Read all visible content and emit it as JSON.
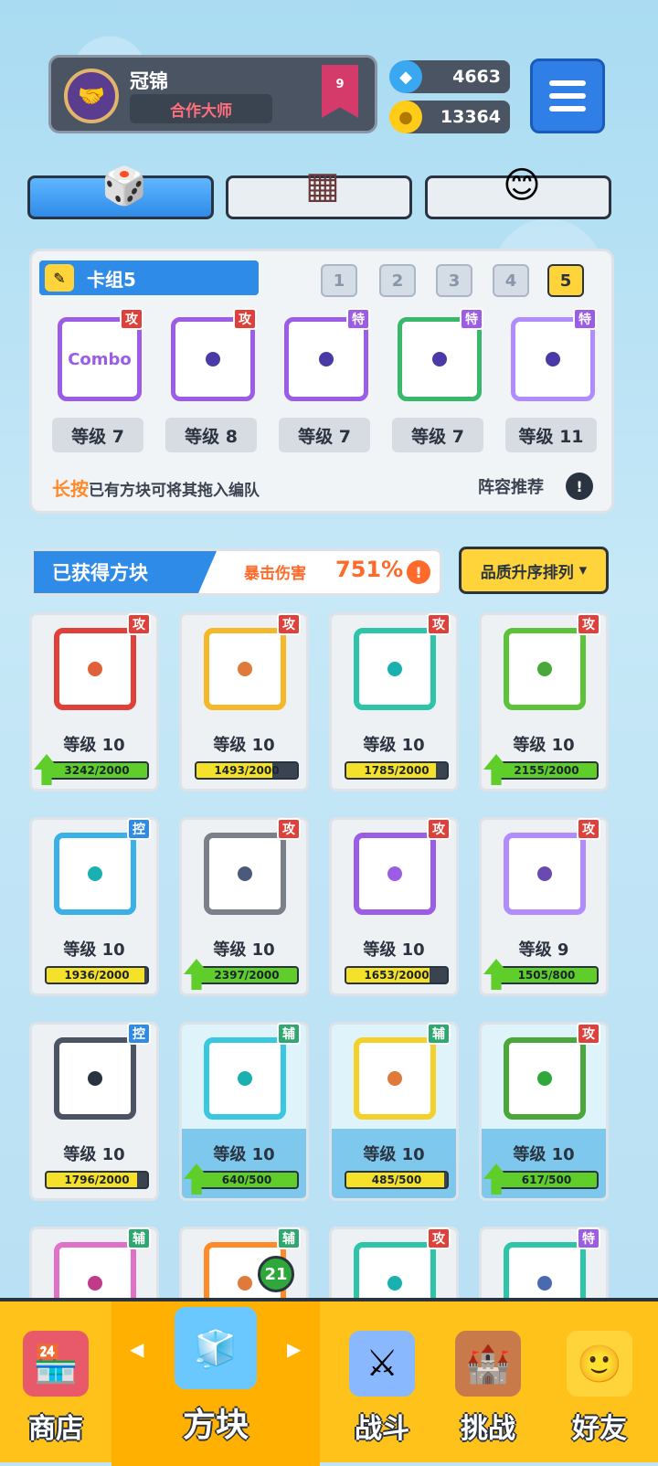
{
  "profile": {
    "name": "冠锦",
    "title": "合作大师",
    "rank": "9"
  },
  "currency": {
    "gems": "4663",
    "coins": "13364"
  },
  "deck": {
    "label": "卡组5",
    "numbers": [
      "1",
      "2",
      "3",
      "4",
      "5"
    ],
    "active": "5",
    "slots": [
      {
        "badge": "攻",
        "badge_color": "#e0403a",
        "color": "#9b5de5",
        "level": "等级 7",
        "text": "Combo"
      },
      {
        "badge": "攻",
        "badge_color": "#e0403a",
        "color": "#9b5de5",
        "level": "等级 8",
        "text": ""
      },
      {
        "badge": "特",
        "badge_color": "#9b5de5",
        "color": "#9b5de5",
        "level": "等级 7",
        "text": ""
      },
      {
        "badge": "特",
        "badge_color": "#9b5de5",
        "color": "#38b86a",
        "level": "等级 7",
        "text": ""
      },
      {
        "badge": "特",
        "badge_color": "#9b5de5",
        "color": "#b08cff",
        "level": "等级 11",
        "text": ""
      }
    ],
    "hint_em": "长按",
    "hint_rest": "已有方块可将其拖入编队",
    "recommend": "阵容推荐"
  },
  "owned": {
    "label": "已获得方块",
    "crit_label": "暴击伤害",
    "crit_value": "751%",
    "sort": "品质升序排列"
  },
  "cards": [
    {
      "badge": "攻",
      "badge_color": "#e0403a",
      "border": "#e0403a",
      "dot": "#e0603a",
      "level": "等级 10",
      "progress": "3242/2000",
      "frac": 1,
      "arrow": true,
      "bluebg": false
    },
    {
      "badge": "攻",
      "badge_color": "#e0403a",
      "border": "#f5b82a",
      "dot": "#e07a3a",
      "level": "等级 10",
      "progress": "1493/2000",
      "frac": 0.75,
      "arrow": false,
      "bluebg": false
    },
    {
      "badge": "攻",
      "badge_color": "#e0403a",
      "border": "#2ec4a8",
      "dot": "#1ab0b0",
      "level": "等级 10",
      "progress": "1785/2000",
      "frac": 0.89,
      "arrow": false,
      "bluebg": false
    },
    {
      "badge": "攻",
      "badge_color": "#e0403a",
      "border": "#5cc23a",
      "dot": "#4aa83a",
      "level": "等级 10",
      "progress": "2155/2000",
      "frac": 1,
      "arrow": true,
      "bluebg": false
    },
    {
      "badge": "控",
      "badge_color": "#2f8be8",
      "border": "#3ab0e8",
      "dot": "#1ab0b0",
      "level": "等级 10",
      "progress": "1936/2000",
      "frac": 0.97,
      "arrow": false,
      "bluebg": false
    },
    {
      "badge": "攻",
      "badge_color": "#e0403a",
      "border": "#7a7f88",
      "dot": "#4a5a7a",
      "level": "等级 10",
      "progress": "2397/2000",
      "frac": 1,
      "arrow": true,
      "bluebg": false
    },
    {
      "badge": "攻",
      "badge_color": "#e0403a",
      "border": "#9b5de5",
      "dot": "#9b5de5",
      "level": "等级 10",
      "progress": "1653/2000",
      "frac": 0.83,
      "arrow": false,
      "bluebg": false
    },
    {
      "badge": "攻",
      "badge_color": "#e0403a",
      "border": "#b08cff",
      "dot": "#6a4ab0",
      "level": "等级 9",
      "progress": "1505/800",
      "frac": 1,
      "arrow": true,
      "bluebg": false
    },
    {
      "badge": "控",
      "badge_color": "#2f8be8",
      "border": "#4a5462",
      "dot": "#2a3340",
      "level": "等级 10",
      "progress": "1796/2000",
      "frac": 0.9,
      "arrow": false,
      "bluebg": false
    },
    {
      "badge": "辅",
      "badge_color": "#2ea870",
      "border": "#3ac8e0",
      "dot": "#1ab0b0",
      "level": "等级 10",
      "progress": "640/500",
      "frac": 1,
      "arrow": true,
      "bluebg": true
    },
    {
      "badge": "辅",
      "badge_color": "#2ea870",
      "border": "#f5d02a",
      "dot": "#e07a3a",
      "level": "等级 10",
      "progress": "485/500",
      "frac": 0.97,
      "arrow": false,
      "bluebg": true
    },
    {
      "badge": "攻",
      "badge_color": "#e0403a",
      "border": "#4aa83a",
      "dot": "#2ea83a",
      "level": "等级 10",
      "progress": "617/500",
      "frac": 1,
      "arrow": true,
      "bluebg": true
    },
    {
      "badge": "辅",
      "badge_color": "#2ea870",
      "border": "#e070c8",
      "dot": "#c03a8a",
      "level": "",
      "progress": "",
      "frac": 0,
      "arrow": false,
      "bluebg": false
    },
    {
      "badge": "辅",
      "badge_color": "#2ea870",
      "border": "#ff8a2a",
      "dot": "#e07a3a",
      "level": "",
      "progress": "",
      "frac": 0,
      "arrow": false,
      "bluebg": false
    },
    {
      "badge": "攻",
      "badge_color": "#e0403a",
      "border": "#2ec4a8",
      "dot": "#1ab0b0",
      "level": "",
      "progress": "",
      "frac": 0,
      "arrow": false,
      "bluebg": false
    },
    {
      "badge": "特",
      "badge_color": "#9b5de5",
      "border": "#2ec4a8",
      "dot": "#4a6ab0",
      "level": "",
      "progress": "",
      "frac": 0,
      "arrow": false,
      "bluebg": false
    }
  ],
  "nav": {
    "shop": "商店",
    "blocks": "方块",
    "blocks_count": "21",
    "battle": "战斗",
    "challenge": "挑战",
    "friends": "好友"
  }
}
